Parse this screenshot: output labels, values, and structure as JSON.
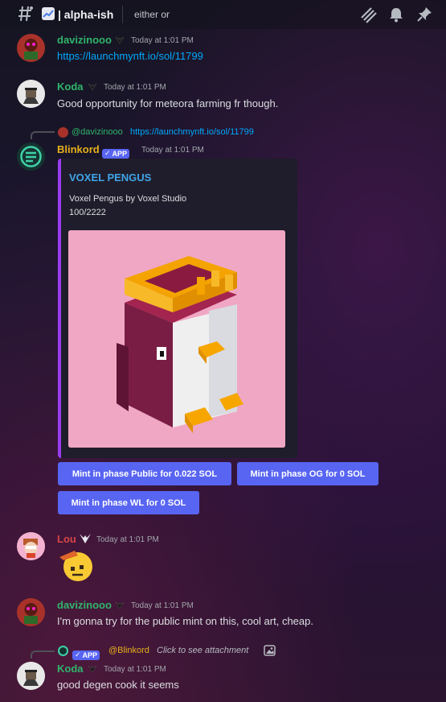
{
  "header": {
    "title": "| alpha-ish",
    "topic": "either or"
  },
  "messages": {
    "m1": {
      "author": "davizinooo",
      "time": "Today at 1:01 PM",
      "link": "https://launchmynft.io/sol/11799"
    },
    "m2": {
      "author": "Koda",
      "time": "Today at 1:01 PM",
      "text": "Good opportunity for meteora farming fr though."
    },
    "m3": {
      "reply_author": "@davizinooo",
      "reply_text": "https://launchmynft.io/sol/11799",
      "author": "Blinkord",
      "app_badge": "APP",
      "time": "Today at 1:01 PM",
      "embed": {
        "title": "VOXEL PENGUS",
        "line1": "Voxel Pengus by Voxel Studio",
        "line2": "100/2222"
      },
      "buttons": [
        "Mint in phase Public for 0.022 SOL",
        "Mint in phase OG for 0 SOL",
        "Mint in phase WL for 0 SOL"
      ]
    },
    "m4": {
      "author": "Lou",
      "time": "Today at 1:01 PM"
    },
    "m5": {
      "author": "davizinooo",
      "time": "Today at 1:01 PM",
      "text": "I'm gonna try for the public mint on this, cool art, cheap."
    },
    "m6": {
      "reply_badge": "APP",
      "reply_author": "@Blinkord",
      "reply_text": "Click to see attachment",
      "author": "Koda",
      "time": "Today at 1:01 PM",
      "text": "good degen cook it seems"
    }
  },
  "colors": {
    "green_name": "#2fb56a",
    "yellow_name": "#e6b01c",
    "red_name": "#d64545",
    "link": "#00a8fc",
    "button": "#5865f2",
    "embed_border": "#9b3cf0"
  }
}
